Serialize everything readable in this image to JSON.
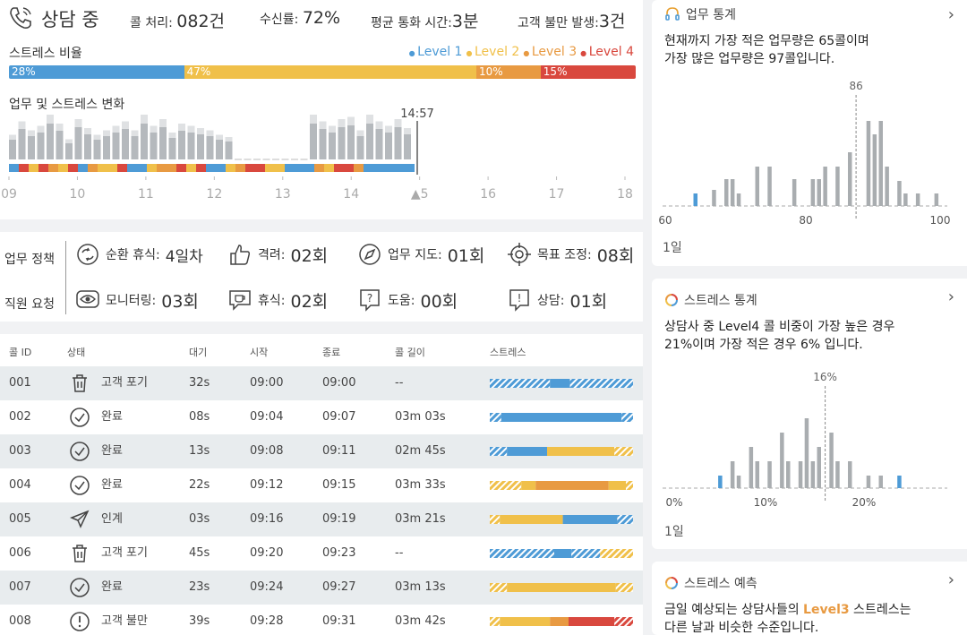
{
  "header": {
    "status": "상담 중",
    "calls_label": "콜 처리:",
    "calls_value": "082건",
    "rate_label": "수신률:",
    "rate_value": "72%",
    "avg_label": "평균 통화 시간:",
    "avg_value": "3분",
    "complaint_label": "고객 불만 발생:",
    "complaint_value": "3건"
  },
  "stress_ratio": {
    "title": "스트레스 비율",
    "legend": [
      "Level 1",
      "Level 2",
      "Level 3",
      "Level 4"
    ],
    "colors": [
      "#4e9bd6",
      "#f0c04a",
      "#e89a42",
      "#d9483e"
    ],
    "segments": [
      {
        "label": "28%",
        "value": 28
      },
      {
        "label": "47%",
        "value": 47
      },
      {
        "label": "10%",
        "value": 10
      },
      {
        "label": "15%",
        "value": 15
      }
    ]
  },
  "timeline": {
    "title": "업무 및 스트레스 변화",
    "current_time": "14:57",
    "ticks": [
      "09",
      "10",
      "11",
      "12",
      "13",
      "14",
      "▲5",
      "16",
      "17",
      "18"
    ]
  },
  "policy": {
    "work_label": "업무 정책",
    "staff_label": "직원 요청",
    "items": [
      {
        "label": "순환 휴식:",
        "value": "4일차"
      },
      {
        "label": "격려:",
        "value": "02회"
      },
      {
        "label": "업무 지도:",
        "value": "01회"
      },
      {
        "label": "목표 조정:",
        "value": "08회"
      },
      {
        "label": "모니터링:",
        "value": "03회"
      },
      {
        "label": "휴식:",
        "value": "02회"
      },
      {
        "label": "도움:",
        "value": "00회"
      },
      {
        "label": "상담:",
        "value": "01회"
      }
    ]
  },
  "table": {
    "headers": [
      "콜 ID",
      "상태",
      "대기",
      "시작",
      "종료",
      "콜 길이",
      "스트레스"
    ],
    "rows": [
      {
        "id": "001",
        "status": "고객 포기",
        "icon": "trash-icon",
        "wait": "32s",
        "start": "09:00",
        "end": "09:00",
        "length": "--"
      },
      {
        "id": "002",
        "status": "완료",
        "icon": "check-circle-icon",
        "wait": "08s",
        "start": "09:04",
        "end": "09:07",
        "length": "03m 03s"
      },
      {
        "id": "003",
        "status": "완료",
        "icon": "check-circle-icon",
        "wait": "13s",
        "start": "09:08",
        "end": "09:11",
        "length": "02m 45s"
      },
      {
        "id": "004",
        "status": "완료",
        "icon": "check-circle-icon",
        "wait": "22s",
        "start": "09:12",
        "end": "09:15",
        "length": "03m 33s"
      },
      {
        "id": "005",
        "status": "인계",
        "icon": "send-icon",
        "wait": "03s",
        "start": "09:16",
        "end": "09:19",
        "length": "03m 21s"
      },
      {
        "id": "006",
        "status": "고객 포기",
        "icon": "trash-icon",
        "wait": "45s",
        "start": "09:20",
        "end": "09:23",
        "length": "--"
      },
      {
        "id": "007",
        "status": "완료",
        "icon": "check-circle-icon",
        "wait": "23s",
        "start": "09:24",
        "end": "09:27",
        "length": "03m 13s"
      },
      {
        "id": "008",
        "status": "고객 불만",
        "icon": "alert-circle-icon",
        "wait": "39s",
        "start": "09:28",
        "end": "09:31",
        "length": "03m 42s"
      }
    ]
  },
  "work_stats": {
    "title": "업무 통계",
    "text1": "현재까지 가장 적은 업무량은 65콜이며",
    "text2": "가장 많은 업무량은 97콜입니다.",
    "marker": "86",
    "xticks": [
      "60",
      "80",
      "100"
    ],
    "period": "1일"
  },
  "stress_stats": {
    "title": "스트레스 통계",
    "text1": "상담사 중 Level4 콜 비중이 가장 높은 경우",
    "text2": "21%이며 가장 적은 경우 6% 입니다.",
    "marker": "16%",
    "xticks": [
      "0%",
      "10%",
      "20%"
    ],
    "period": "1일"
  },
  "forecast": {
    "title": "스트레스 예측",
    "text_pre": "금일 예상되는 상담사들의 ",
    "highlight": "Level3",
    "text_post": " 스트레스는",
    "text2": "다른 날과 비슷한 수준입니다."
  }
}
